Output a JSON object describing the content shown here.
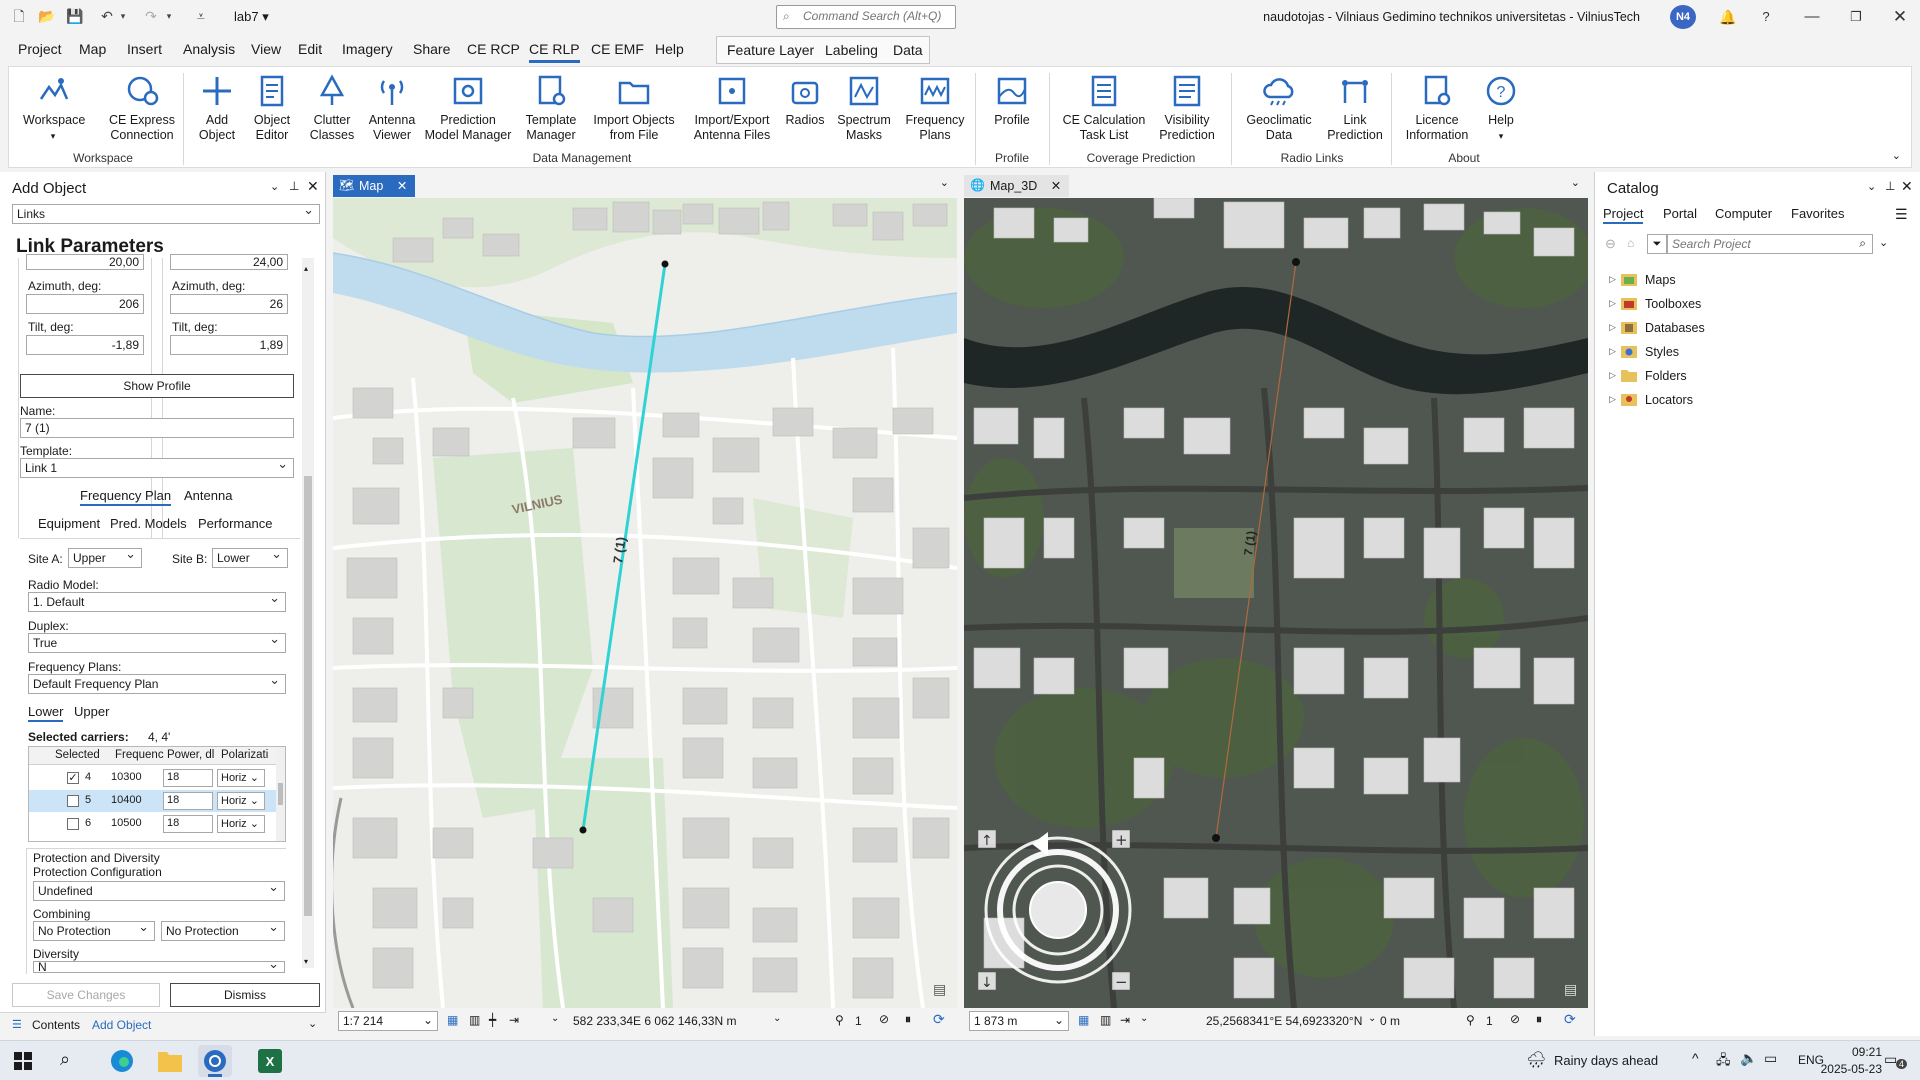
{
  "titlebar": {
    "project_name": "lab7",
    "command_search_placeholder": "Command Search (Alt+Q)",
    "user_org": "naudotojas - Vilniaus Gedimino technikos universitetas - VilniusTech",
    "avatar": "N4",
    "help": "?"
  },
  "menu": {
    "tabs": [
      "Project",
      "Map",
      "Insert",
      "Analysis",
      "View",
      "Edit",
      "Imagery",
      "Share",
      "CE RCP",
      "CE RLP",
      "CE EMF",
      "Help"
    ],
    "active": "CE RLP",
    "context_tabs": [
      "Feature Layer",
      "Labeling",
      "Data"
    ]
  },
  "ribbon": {
    "buttons": [
      {
        "label": "Workspace",
        "icon": "workspace-icon"
      },
      {
        "label": "CE Express Connection",
        "icon": "gear-globe-icon"
      },
      {
        "label": "Add Object",
        "icon": "plus-icon"
      },
      {
        "label": "Object Editor",
        "icon": "edit-doc-icon"
      },
      {
        "label": "Clutter Classes",
        "icon": "tree-icon"
      },
      {
        "label": "Antenna Viewer",
        "icon": "antenna-icon"
      },
      {
        "label": "Prediction Model Manager",
        "icon": "model-gear-icon"
      },
      {
        "label": "Template Manager",
        "icon": "template-icon"
      },
      {
        "label": "Import Objects from File",
        "icon": "folder-icon"
      },
      {
        "label": "Import/Export Antenna Files",
        "icon": "antenna-file-icon"
      },
      {
        "label": "Radios",
        "icon": "radio-icon"
      },
      {
        "label": "Spectrum Masks",
        "icon": "spectrum-icon"
      },
      {
        "label": "Frequency Plans",
        "icon": "frequency-icon"
      },
      {
        "label": "Profile",
        "icon": "profile-icon"
      },
      {
        "label": "CE Calculation Task List",
        "icon": "tasklist-icon"
      },
      {
        "label": "Visibility Prediction",
        "icon": "visibility-icon"
      },
      {
        "label": "Geoclimatic Data",
        "icon": "cloud-icon"
      },
      {
        "label": "Link Prediction",
        "icon": "link-icon"
      },
      {
        "label": "Licence Information",
        "icon": "licence-icon"
      },
      {
        "label": "Help",
        "icon": "help-icon"
      }
    ],
    "groups": [
      "Workspace",
      "Data Management",
      "Profile",
      "Coverage Prediction",
      "Radio Links",
      "About"
    ]
  },
  "add_object": {
    "title": "Add Object",
    "type": "Links",
    "section_title": "Link Parameters",
    "height_a": "20,00",
    "height_b": "24,00",
    "azimuth_label": "Azimuth, deg:",
    "azimuth_a": "206",
    "azimuth_b": "26",
    "tilt_label": "Tilt, deg:",
    "tilt_a": "-1,89",
    "tilt_b": "1,89",
    "show_profile": "Show Profile",
    "name_label": "Name:",
    "name_value": "7 (1)",
    "template_label": "Template:",
    "template_value": "Link 1",
    "tabs_row1": [
      "Frequency Plan",
      "Antenna"
    ],
    "tabs_row2": [
      "Equipment",
      "Pred. Models",
      "Performance"
    ],
    "site_a_label": "Site A:",
    "site_a_value": "Upper",
    "site_b_label": "Site B:",
    "site_b_value": "Lower",
    "radio_model_label": "Radio Model:",
    "radio_model_value": "1. Default",
    "duplex_label": "Duplex:",
    "duplex_value": "True",
    "freq_plans_label": "Frequency Plans:",
    "freq_plans_value": "Default Frequency Plan",
    "sub_tabs": [
      "Lower",
      "Upper"
    ],
    "selected_carriers_label": "Selected carriers:",
    "selected_carriers_value": "4, 4'",
    "carrier_headers": [
      "Selected",
      "Frequenc",
      "Power, dl",
      "Polarizati"
    ],
    "carriers": [
      {
        "checked": "✓",
        "id": "4",
        "freq": "10300",
        "power": "18",
        "pol": "Horiz"
      },
      {
        "checked": "",
        "id": "5",
        "freq": "10400",
        "power": "18",
        "pol": "Horiz"
      },
      {
        "checked": "",
        "id": "6",
        "freq": "10500",
        "power": "18",
        "pol": "Horiz"
      }
    ],
    "protection_title": "Protection and Diversity",
    "protection_config_label": "Protection Configuration",
    "protection_config_value": "Undefined",
    "combining_label": "Combining",
    "combining_a": "No Protection",
    "combining_b": "No Protection",
    "diversity_label": "Diversity",
    "diversity_value": "N",
    "save_changes": "Save Changes",
    "dismiss": "Dismiss",
    "bottom_tabs": [
      "Contents",
      "Add Object"
    ]
  },
  "map2d": {
    "tab": "Map",
    "city_label": "VILNIUS",
    "link_label": "7 (1)",
    "scale": "1:7 214",
    "coords": "582 233,34E 6 062 146,33N m",
    "selected_count": "1"
  },
  "map3d": {
    "tab": "Map_3D",
    "link_label": "7 (1)",
    "distance": "1 873 m",
    "coords": "25,2568341°E 54,6923320°N",
    "elevation": "0 m",
    "selected_count": "1"
  },
  "catalog": {
    "title": "Catalog",
    "tabs": [
      "Project",
      "Portal",
      "Computer",
      "Favorites"
    ],
    "search_placeholder": "Search Project",
    "items": [
      "Maps",
      "Toolboxes",
      "Databases",
      "Styles",
      "Folders",
      "Locators"
    ]
  },
  "taskbar": {
    "weather": "Rainy days ahead",
    "lang": "ENG",
    "time": "09:21",
    "date": "2025-05-23",
    "notif": "4"
  },
  "colors": {
    "accent": "#2a6bbf",
    "link_line": "#2fd3d6",
    "river": "#bfdbee",
    "park": "#d5e6c9"
  }
}
